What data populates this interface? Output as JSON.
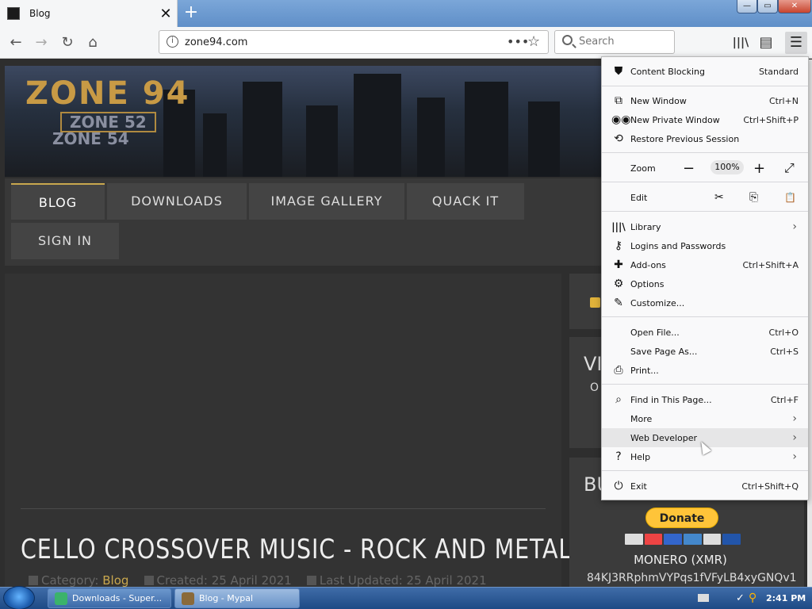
{
  "tab": {
    "title": "Blog",
    "close": "✕",
    "new_tab": "+"
  },
  "window": {
    "minimize": "—",
    "maximize": "▭",
    "close": "✕"
  },
  "nav": {
    "back": "←",
    "forward": "→",
    "reload": "↻",
    "home": "⌂"
  },
  "urlbar": {
    "url": "zone94.com",
    "more": "•••",
    "bookmark": "☆"
  },
  "search": {
    "placeholder": "Search"
  },
  "toolbar": {
    "library": "|||\\",
    "sidebar": "▤",
    "menu": "☰"
  },
  "site": {
    "logo_main": "ZONE 94",
    "logo_sub1": "ZONE 52",
    "logo_sub2": "ZONE 54",
    "menu": [
      "BLOG",
      "DOWNLOADS",
      "IMAGE GALLERY",
      "QUACK IT",
      "SIGN IN"
    ],
    "article_title": "CELLO CROSSOVER MUSIC - ROCK AND METAL",
    "meta": {
      "category_label": "Category:",
      "category": "Blog",
      "created": "Created: 25 April 2021",
      "updated": "Last Updated: 25 April 2021"
    },
    "sidebar": {
      "vi": "VI",
      "vio": "O",
      "bu": "BU",
      "donate": "Donate",
      "monero": "MONERO (XMR)",
      "address": "84KJ3RRphmVYPqs1fVFyLB4xyGNQv1"
    }
  },
  "menu": {
    "content_blocking": {
      "label": "Content Blocking",
      "value": "Standard"
    },
    "new_window": {
      "label": "New Window",
      "shortcut": "Ctrl+N"
    },
    "new_private": {
      "label": "New Private Window",
      "shortcut": "Ctrl+Shift+P"
    },
    "restore": {
      "label": "Restore Previous Session"
    },
    "zoom": {
      "label": "Zoom",
      "minus": "−",
      "value": "100%",
      "plus": "+",
      "fullscreen": "⤢"
    },
    "edit": {
      "label": "Edit",
      "cut": "✂",
      "copy": "⎘",
      "paste": "📋"
    },
    "library": {
      "label": "Library"
    },
    "logins": {
      "label": "Logins and Passwords"
    },
    "addons": {
      "label": "Add-ons",
      "shortcut": "Ctrl+Shift+A"
    },
    "options": {
      "label": "Options"
    },
    "customize": {
      "label": "Customize..."
    },
    "open_file": {
      "label": "Open File...",
      "shortcut": "Ctrl+O"
    },
    "save_page": {
      "label": "Save Page As...",
      "shortcut": "Ctrl+S"
    },
    "print": {
      "label": "Print..."
    },
    "find": {
      "label": "Find in This Page...",
      "shortcut": "Ctrl+F"
    },
    "more": {
      "label": "More"
    },
    "web_developer": {
      "label": "Web Developer"
    },
    "help": {
      "label": "Help"
    },
    "exit": {
      "label": "Exit",
      "shortcut": "Ctrl+Shift+Q"
    },
    "arrow": "›"
  },
  "taskbar": {
    "items": [
      {
        "label": "Downloads - Super..."
      },
      {
        "label": "Blog - Mypal"
      }
    ],
    "clock": "2:41 PM"
  }
}
